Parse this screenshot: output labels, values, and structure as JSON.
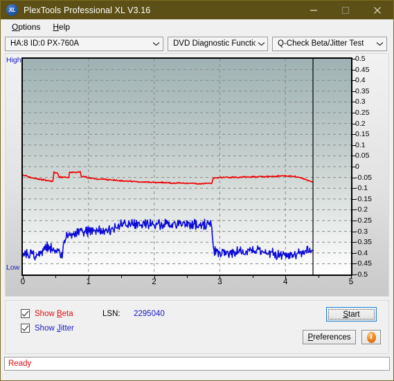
{
  "window": {
    "title": "PlexTools Professional XL V3.16",
    "icon": "xl-app-icon",
    "minimize": "minimize-icon",
    "maximize": "maximize-icon",
    "close": "close-icon",
    "titlebar_color": "#5d5016"
  },
  "menu": [
    {
      "label": "Options",
      "accel": "O"
    },
    {
      "label": "Help",
      "accel": "H"
    }
  ],
  "toolbar": {
    "drive_select": "HA:8 ID:0  PX-760A",
    "function_select": "DVD Diagnostic Functions",
    "test_select": "Q-Check Beta/Jitter Test",
    "chevron": "chevron-down-icon"
  },
  "controls": {
    "show_beta_label": "Show Beta",
    "show_beta_accel": "B",
    "show_beta_checked": true,
    "show_jitter_label": "Show Jitter",
    "show_jitter_accel": "J",
    "show_jitter_checked": true,
    "lsn_label": "LSN:",
    "lsn_value": "2295040",
    "start_label": "Start",
    "start_accel": "S",
    "preferences_label": "Preferences",
    "preferences_accel": "P",
    "info_label": "i"
  },
  "status": {
    "text": "Ready",
    "color": "#e01010"
  },
  "chart_data": {
    "type": "line",
    "title": "",
    "xlabel": "",
    "ylabel": "",
    "xlim": [
      0,
      5
    ],
    "ylim": [
      -0.5,
      0.5
    ],
    "grid": true,
    "legend": "none",
    "axis_left_top_label": "High",
    "axis_left_bottom_label": "Low",
    "ytick_labels": [
      "0.5",
      "0.45",
      "0.4",
      "0.35",
      "0.3",
      "0.25",
      "0.2",
      "0.15",
      "0.1",
      "0.05",
      "0",
      "-0.05",
      "-0.1",
      "-0.15",
      "-0.2",
      "-0.25",
      "-0.3",
      "-0.35",
      "-0.4",
      "-0.45",
      "-0.5"
    ],
    "ytick_values": [
      0.5,
      0.45,
      0.4,
      0.35,
      0.3,
      0.25,
      0.2,
      0.15,
      0.1,
      0.05,
      0,
      -0.05,
      -0.1,
      -0.15,
      -0.2,
      -0.25,
      -0.3,
      -0.35,
      -0.4,
      -0.45,
      -0.5
    ],
    "xtick_labels": [
      "0",
      "1",
      "2",
      "3",
      "4",
      "5"
    ],
    "xtick_values": [
      0,
      1,
      2,
      3,
      4,
      5
    ],
    "cursor_x": 4.42,
    "data_end_x": 4.42,
    "series": [
      {
        "name": "Beta",
        "color": "#ee0000",
        "noise": 0.004,
        "points": [
          [
            0.0,
            -0.038
          ],
          [
            0.06,
            -0.044
          ],
          [
            0.12,
            -0.05
          ],
          [
            0.2,
            -0.056
          ],
          [
            0.28,
            -0.06
          ],
          [
            0.36,
            -0.064
          ],
          [
            0.42,
            -0.068
          ],
          [
            0.46,
            -0.07
          ],
          [
            0.47,
            -0.028
          ],
          [
            0.5,
            -0.028
          ],
          [
            0.53,
            -0.03
          ],
          [
            0.55,
            -0.048
          ],
          [
            0.6,
            -0.048
          ],
          [
            0.66,
            -0.049
          ],
          [
            0.7,
            -0.049
          ],
          [
            0.71,
            -0.026
          ],
          [
            0.8,
            -0.026
          ],
          [
            0.88,
            -0.026
          ],
          [
            0.89,
            -0.046
          ],
          [
            0.95,
            -0.048
          ],
          [
            1.0,
            -0.052
          ],
          [
            1.1,
            -0.056
          ],
          [
            1.2,
            -0.058
          ],
          [
            1.35,
            -0.062
          ],
          [
            1.5,
            -0.065
          ],
          [
            1.7,
            -0.069
          ],
          [
            1.9,
            -0.072
          ],
          [
            2.1,
            -0.074
          ],
          [
            2.3,
            -0.076
          ],
          [
            2.5,
            -0.077
          ],
          [
            2.7,
            -0.078
          ],
          [
            2.85,
            -0.078
          ],
          [
            2.88,
            -0.078
          ],
          [
            2.9,
            -0.052
          ],
          [
            3.0,
            -0.05
          ],
          [
            3.2,
            -0.049
          ],
          [
            3.4,
            -0.048
          ],
          [
            3.6,
            -0.047
          ],
          [
            3.8,
            -0.045
          ],
          [
            3.95,
            -0.043
          ],
          [
            4.05,
            -0.043
          ],
          [
            4.15,
            -0.046
          ],
          [
            4.25,
            -0.053
          ],
          [
            4.33,
            -0.062
          ],
          [
            4.4,
            -0.07
          ],
          [
            4.42,
            -0.072
          ]
        ]
      },
      {
        "name": "Jitter",
        "color": "#0b0bd8",
        "noise": 0.028,
        "points": [
          [
            0.0,
            -0.41
          ],
          [
            0.05,
            -0.405
          ],
          [
            0.1,
            -0.412
          ],
          [
            0.15,
            -0.402
          ],
          [
            0.2,
            -0.408
          ],
          [
            0.25,
            -0.4
          ],
          [
            0.3,
            -0.392
          ],
          [
            0.35,
            -0.375
          ],
          [
            0.4,
            -0.372
          ],
          [
            0.45,
            -0.378
          ],
          [
            0.5,
            -0.395
          ],
          [
            0.55,
            -0.4
          ],
          [
            0.58,
            -0.405
          ],
          [
            0.6,
            -0.398
          ],
          [
            0.62,
            -0.355
          ],
          [
            0.66,
            -0.33
          ],
          [
            0.7,
            -0.322
          ],
          [
            0.75,
            -0.318
          ],
          [
            0.8,
            -0.312
          ],
          [
            0.85,
            -0.305
          ],
          [
            0.9,
            -0.3
          ],
          [
            0.95,
            -0.3
          ],
          [
            1.0,
            -0.298
          ],
          [
            1.05,
            -0.295
          ],
          [
            1.1,
            -0.293
          ],
          [
            1.15,
            -0.296
          ],
          [
            1.2,
            -0.3
          ],
          [
            1.25,
            -0.302
          ],
          [
            1.3,
            -0.298
          ],
          [
            1.35,
            -0.292
          ],
          [
            1.4,
            -0.285
          ],
          [
            1.45,
            -0.278
          ],
          [
            1.5,
            -0.272
          ],
          [
            1.55,
            -0.268
          ],
          [
            1.6,
            -0.266
          ],
          [
            1.7,
            -0.265
          ],
          [
            1.8,
            -0.266
          ],
          [
            1.9,
            -0.266
          ],
          [
            2.0,
            -0.268
          ],
          [
            2.1,
            -0.267
          ],
          [
            2.2,
            -0.268
          ],
          [
            2.3,
            -0.27
          ],
          [
            2.4,
            -0.268
          ],
          [
            2.5,
            -0.267
          ],
          [
            2.6,
            -0.268
          ],
          [
            2.7,
            -0.27
          ],
          [
            2.8,
            -0.27
          ],
          [
            2.86,
            -0.268
          ],
          [
            2.88,
            -0.27
          ],
          [
            2.9,
            -0.385
          ],
          [
            2.95,
            -0.398
          ],
          [
            3.0,
            -0.4
          ],
          [
            3.1,
            -0.398
          ],
          [
            3.2,
            -0.395
          ],
          [
            3.3,
            -0.392
          ],
          [
            3.4,
            -0.388
          ],
          [
            3.5,
            -0.385
          ],
          [
            3.6,
            -0.388
          ],
          [
            3.7,
            -0.395
          ],
          [
            3.8,
            -0.402
          ],
          [
            3.9,
            -0.408
          ],
          [
            4.0,
            -0.412
          ],
          [
            4.1,
            -0.408
          ],
          [
            4.2,
            -0.398
          ],
          [
            4.3,
            -0.392
          ],
          [
            4.38,
            -0.39
          ],
          [
            4.42,
            -0.392
          ]
        ]
      }
    ]
  }
}
